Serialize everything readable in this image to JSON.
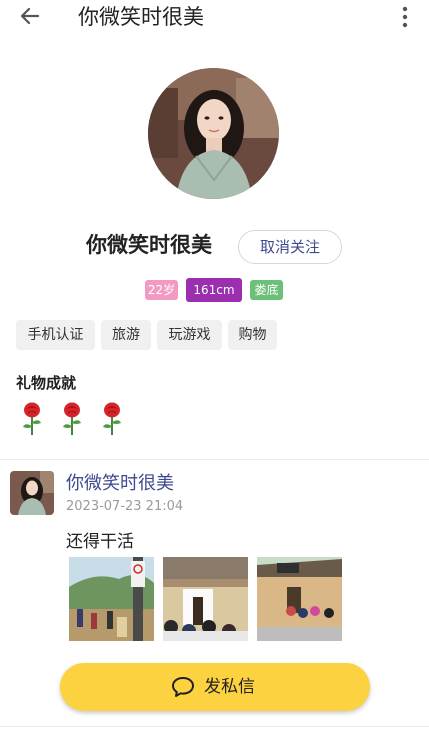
{
  "header": {
    "title": "你微笑时很美",
    "back_icon": "arrow-left-icon",
    "more_icon": "more-vertical-icon"
  },
  "profile": {
    "name": "你微笑时很美",
    "unfollow_label": "取消关注",
    "badges": {
      "age": "22岁",
      "height": "161cm",
      "city": "娄底"
    },
    "tags": [
      "手机认证",
      "旅游",
      "玩游戏",
      "购物"
    ]
  },
  "gifts": {
    "title": "礼物成就",
    "icon": "rose-icon"
  },
  "post": {
    "author": "你微笑时很美",
    "time": "2023-07-23 21:04",
    "text": "还得干活"
  },
  "actions": {
    "message_label": "发私信",
    "message_icon": "chat-bubble-icon"
  },
  "colors": {
    "accent_yellow": "#fcd241",
    "link_blue": "#3d4a8f",
    "age_pink": "#f29ac2",
    "height_purple": "#9b2fb0",
    "city_green": "#6cc07a"
  }
}
